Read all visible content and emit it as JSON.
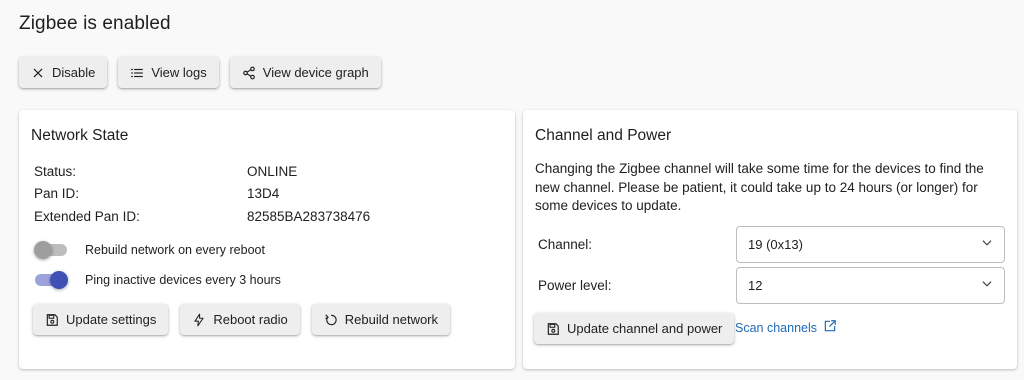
{
  "page": {
    "title": "Zigbee is enabled"
  },
  "top_actions": {
    "disable": {
      "label": "Disable",
      "icon": "close-icon"
    },
    "view_logs": {
      "label": "View logs",
      "icon": "list-icon"
    },
    "view_graph": {
      "label": "View device graph",
      "icon": "share-icon"
    }
  },
  "network_state": {
    "title": "Network State",
    "status": {
      "label": "Status:",
      "value": "ONLINE"
    },
    "pan_id": {
      "label": "Pan ID:",
      "value": "13D4"
    },
    "extended_pan_id": {
      "label": "Extended Pan ID:",
      "value": "82585BA283738476"
    },
    "toggles": [
      {
        "label": "Rebuild network on every reboot",
        "checked": false
      },
      {
        "label": "Ping inactive devices every 3 hours",
        "checked": true
      }
    ],
    "actions": {
      "update_settings": "Update settings",
      "reboot_radio": "Reboot radio",
      "rebuild_network": "Rebuild network"
    }
  },
  "channel_power": {
    "title": "Channel and Power",
    "description": "Changing the Zigbee channel will take some time for the devices to find the new channel. Please be patient, it could take up to 24 hours (or longer) for some devices to update.",
    "channel": {
      "label": "Channel:",
      "value": "19 (0x13)"
    },
    "power": {
      "label": "Power level:",
      "value": "12"
    },
    "update_button": "Update channel and power",
    "scan_link": "Scan channels"
  },
  "colors": {
    "accent": "#3f51b5",
    "link": "#1e6bb8"
  }
}
